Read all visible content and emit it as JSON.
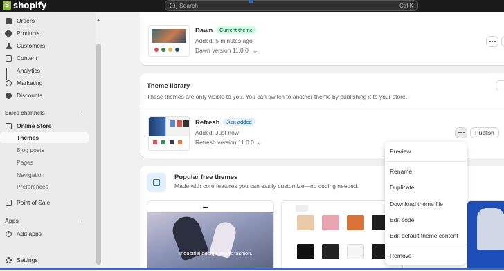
{
  "app": {
    "brand": "shopify",
    "brand_color": "#95bf47"
  },
  "search": {
    "placeholder": "Search",
    "shortcut": "Ctrl K"
  },
  "sidebar": {
    "items": [
      {
        "label": "Orders",
        "icon": "orders-icon"
      },
      {
        "label": "Products",
        "icon": "tag-icon"
      },
      {
        "label": "Customers",
        "icon": "person-icon"
      },
      {
        "label": "Content",
        "icon": "content-icon"
      },
      {
        "label": "Analytics",
        "icon": "bar-chart-icon"
      },
      {
        "label": "Marketing",
        "icon": "target-icon"
      },
      {
        "label": "Discounts",
        "icon": "discount-icon"
      }
    ],
    "sales_channels_label": "Sales channels",
    "online_store": {
      "label": "Online Store",
      "icon": "store-icon"
    },
    "online_store_sub": [
      "Themes",
      "Blog posts",
      "Pages",
      "Navigation",
      "Preferences"
    ],
    "point_of_sale": {
      "label": "Point of Sale",
      "icon": "pos-icon"
    },
    "apps_label": "Apps",
    "add_apps": {
      "label": "Add apps",
      "icon": "plus-circle-icon"
    },
    "settings": {
      "label": "Settings",
      "icon": "gear-icon"
    }
  },
  "current_theme": {
    "name": "Dawn",
    "badge": "Current theme",
    "added": "Added: 5 minutes ago",
    "version": "Dawn version 11.0.0"
  },
  "library": {
    "title": "Theme library",
    "description": "These themes are only visible to you. You can switch to another theme by publishing it to your store.",
    "theme": {
      "name": "Refresh",
      "badge": "Just added",
      "added": "Added: Just now",
      "version": "Refresh version 11.0.0",
      "publish_label": "Publish"
    }
  },
  "menu": {
    "items": [
      "Preview",
      "Rename",
      "Duplicate",
      "Download theme file",
      "Edit code",
      "Edit default theme content",
      "Remove"
    ]
  },
  "popular": {
    "title": "Popular free themes",
    "description": "Made with core features you can easily customize—no coding needed.",
    "preview1_caption": "Industrial design meets fashion."
  }
}
